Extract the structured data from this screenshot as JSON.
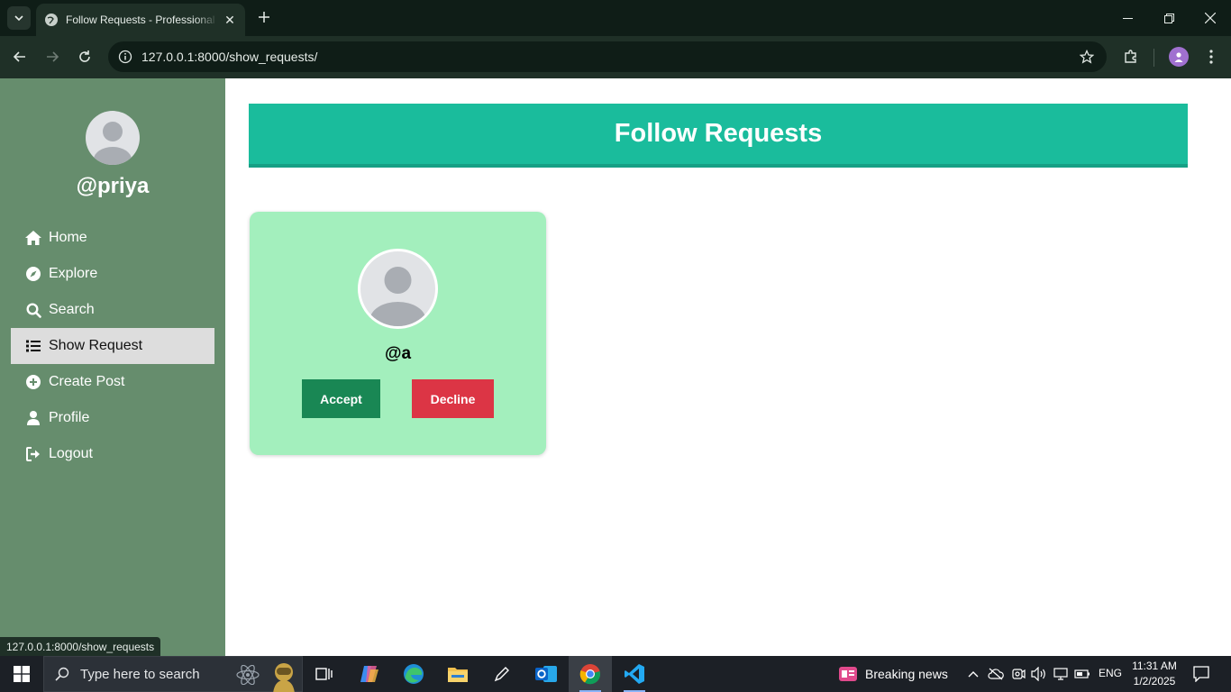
{
  "browser": {
    "tab_title": "Follow Requests - Professional Network",
    "url": "127.0.0.1:8000/show_requests/",
    "status_url": "127.0.0.1:8000/show_requests"
  },
  "sidebar": {
    "username": "@priya",
    "items": [
      {
        "label": "Home",
        "icon": "home-icon"
      },
      {
        "label": "Explore",
        "icon": "compass-icon"
      },
      {
        "label": "Search",
        "icon": "search-icon"
      },
      {
        "label": "Show Request",
        "icon": "list-icon",
        "active": true
      },
      {
        "label": "Create Post",
        "icon": "plus-circle-icon"
      },
      {
        "label": "Profile",
        "icon": "user-icon"
      },
      {
        "label": "Logout",
        "icon": "logout-icon"
      }
    ]
  },
  "main": {
    "title": "Follow Requests",
    "requests": [
      {
        "username": "@a",
        "accept_label": "Accept",
        "decline_label": "Decline"
      }
    ]
  },
  "taskbar": {
    "search_placeholder": "Type here to search",
    "news": "Breaking news",
    "language": "ENG",
    "time": "11:31 AM",
    "date": "1/2/2025"
  },
  "colors": {
    "sidebar_bg": "#668d6d",
    "header_bg": "#1abc9c",
    "card_bg": "#a3efbd",
    "accept": "#198754",
    "decline": "#dc3545"
  }
}
